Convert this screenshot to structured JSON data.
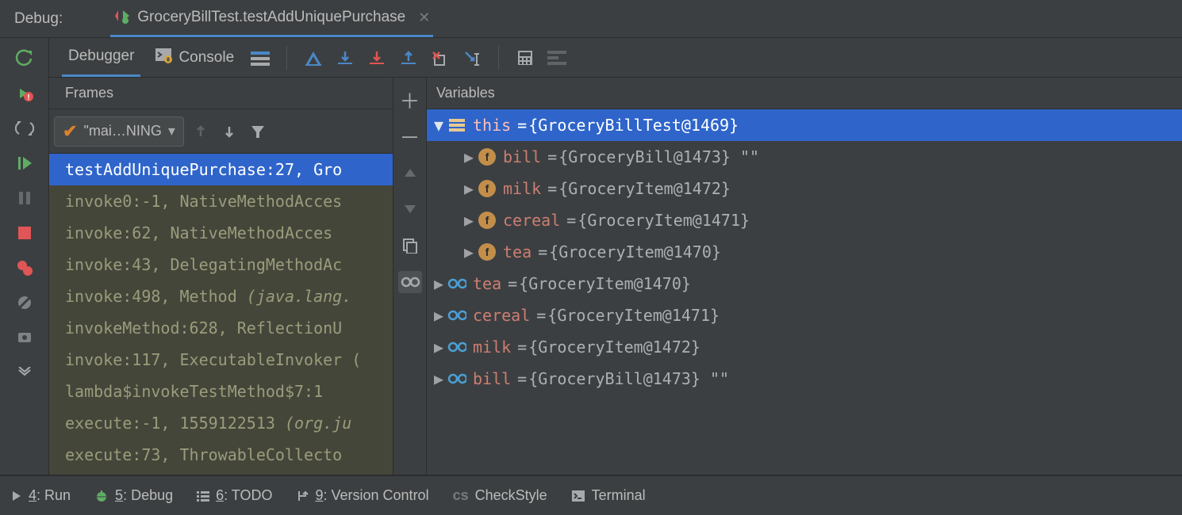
{
  "header": {
    "label": "Debug:",
    "tab_title": "GroceryBillTest.testAddUniquePurchase"
  },
  "subtabs": {
    "debugger": "Debugger",
    "console": "Console"
  },
  "frames": {
    "header": "Frames",
    "thread": "\"mai…NING",
    "rows": [
      {
        "text": "testAddUniquePurchase:27, Gro",
        "sel": true,
        "ital": false
      },
      {
        "text": "invoke0:-1, NativeMethodAcces",
        "sel": false,
        "ital": false
      },
      {
        "text": "invoke:62, NativeMethodAcces",
        "sel": false,
        "ital": false
      },
      {
        "text": "invoke:43, DelegatingMethodAc",
        "sel": false,
        "ital": false
      },
      {
        "text": "invoke:498, Method (java.lang.",
        "sel": false,
        "ital": true
      },
      {
        "text": "invokeMethod:628, ReflectionU",
        "sel": false,
        "ital": false
      },
      {
        "text": "invoke:117, ExecutableInvoker (",
        "sel": false,
        "ital": false
      },
      {
        "text": "lambda$invokeTestMethod$7:1",
        "sel": false,
        "ital": false
      },
      {
        "text": "execute:-1, 1559122513 (org.ju",
        "sel": false,
        "ital": true
      },
      {
        "text": "execute:73, ThrowableCollecto",
        "sel": false,
        "ital": false
      }
    ]
  },
  "variables": {
    "header": "Variables",
    "rows": [
      {
        "indent": 0,
        "exp": "down",
        "kind": "stack",
        "name": "this",
        "val": "{GroceryBillTest@1469}",
        "sel": true
      },
      {
        "indent": 1,
        "exp": "right",
        "kind": "field",
        "name": "bill",
        "val": "{GroceryBill@1473} \"\"",
        "sel": false
      },
      {
        "indent": 1,
        "exp": "right",
        "kind": "field",
        "name": "milk",
        "val": "{GroceryItem@1472}",
        "sel": false
      },
      {
        "indent": 1,
        "exp": "right",
        "kind": "field",
        "name": "cereal",
        "val": "{GroceryItem@1471}",
        "sel": false
      },
      {
        "indent": 1,
        "exp": "right",
        "kind": "field",
        "name": "tea",
        "val": "{GroceryItem@1470}",
        "sel": false
      },
      {
        "indent": 0,
        "exp": "right",
        "kind": "watch",
        "name": "tea",
        "val": "{GroceryItem@1470}",
        "sel": false
      },
      {
        "indent": 0,
        "exp": "right",
        "kind": "watch",
        "name": "cereal",
        "val": "{GroceryItem@1471}",
        "sel": false
      },
      {
        "indent": 0,
        "exp": "right",
        "kind": "watch",
        "name": "milk",
        "val": "{GroceryItem@1472}",
        "sel": false
      },
      {
        "indent": 0,
        "exp": "right",
        "kind": "watch",
        "name": "bill",
        "val": "{GroceryBill@1473} \"\"",
        "sel": false
      }
    ]
  },
  "bottom": {
    "run_num": "4",
    "run": ": Run",
    "debug_num": "5",
    "debug": ": Debug",
    "todo_num": "6",
    "todo": ": TODO",
    "vc_num": "9",
    "vc": ": Version Control",
    "checkstyle": "CheckStyle",
    "terminal": "Terminal"
  }
}
